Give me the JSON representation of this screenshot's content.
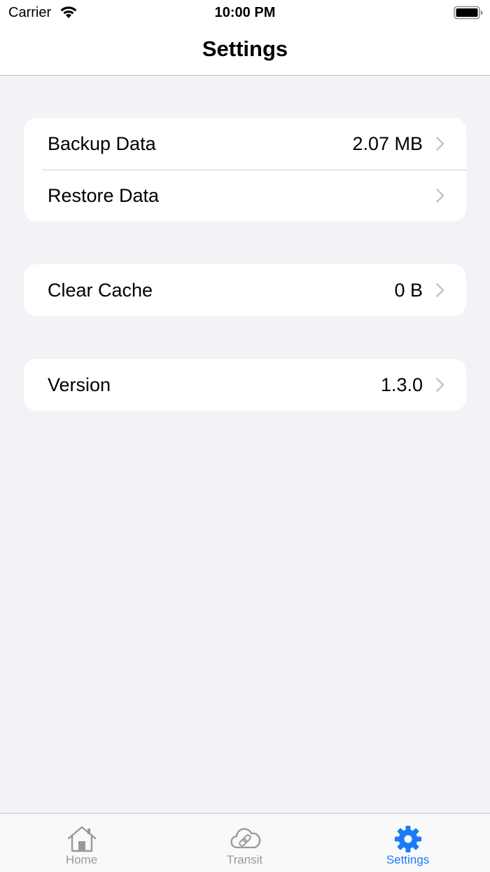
{
  "status_bar": {
    "carrier": "Carrier",
    "time": "10:00 PM"
  },
  "nav": {
    "title": "Settings"
  },
  "groups": [
    {
      "rows": [
        {
          "label": "Backup Data",
          "value": "2.07 MB"
        },
        {
          "label": "Restore Data",
          "value": ""
        }
      ]
    },
    {
      "rows": [
        {
          "label": "Clear Cache",
          "value": "0 B"
        }
      ]
    },
    {
      "rows": [
        {
          "label": "Version",
          "value": "1.3.0"
        }
      ]
    }
  ],
  "tabbar": {
    "tabs": [
      {
        "label": "Home",
        "icon": "house-icon",
        "active": false
      },
      {
        "label": "Transit",
        "icon": "cloud-link-icon",
        "active": false
      },
      {
        "label": "Settings",
        "icon": "gear-icon",
        "active": true
      }
    ]
  },
  "colors": {
    "background": "#f2f2f7",
    "accent": "#1a7cf5",
    "inactive_tab": "#999999",
    "chevron": "#c4c4c7"
  }
}
